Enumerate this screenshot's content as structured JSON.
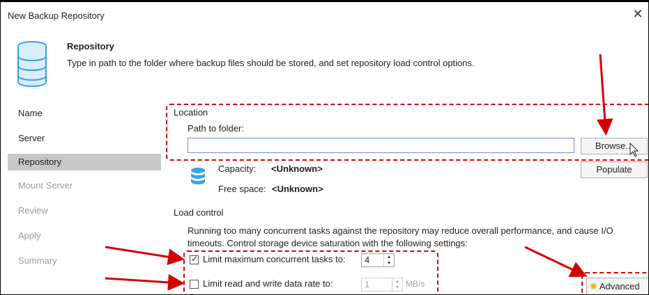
{
  "window": {
    "title": "New Backup Repository",
    "close_glyph": "✕"
  },
  "header": {
    "title": "Repository",
    "description": "Type in path to the folder where backup files should be stored, and set repository load control options.",
    "icon": "database-icon"
  },
  "nav": {
    "items": [
      {
        "label": "Name",
        "state": "normal"
      },
      {
        "label": "Server",
        "state": "normal"
      },
      {
        "label": "Repository",
        "state": "active"
      },
      {
        "label": "Mount Server",
        "state": "disabled"
      },
      {
        "label": "Review",
        "state": "disabled"
      },
      {
        "label": "Apply",
        "state": "disabled"
      },
      {
        "label": "Summary",
        "state": "disabled"
      }
    ]
  },
  "location": {
    "section_label": "Location",
    "path_label": "Path to folder:",
    "path_value": "",
    "browse_label": "Browse...",
    "populate_label": "Populate",
    "capacity_label": "Capacity:",
    "capacity_value": "<Unknown>",
    "free_label": "Free space:",
    "free_value": "<Unknown>"
  },
  "load_control": {
    "section_label": "Load control",
    "description_line1": "Running too many concurrent tasks against the repository may reduce overall performance, and cause I/O",
    "description_line2": "timeouts. Control storage device saturation with the following settings:",
    "limit_tasks_label": "Limit maximum concurrent tasks to:",
    "limit_tasks_checked": true,
    "limit_tasks_value": "4",
    "limit_rate_label": "Limit read and write data rate to:",
    "limit_rate_checked": false,
    "limit_rate_value": "1",
    "limit_rate_unit": "MB/s",
    "advanced_label": "Advanced"
  },
  "colors": {
    "annotation": "#d40000",
    "active_nav": "#c8c8c8",
    "accent": "#3aa0e8"
  }
}
